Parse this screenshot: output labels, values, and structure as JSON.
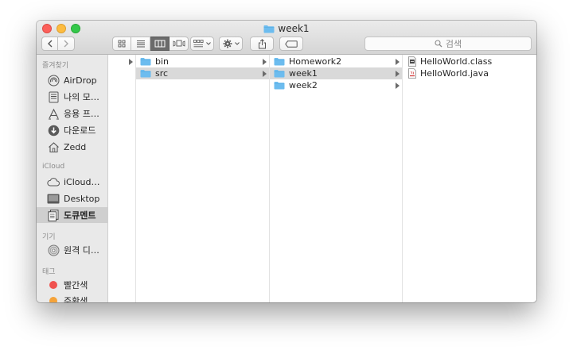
{
  "window": {
    "title": "week1",
    "title_icon": "folder-icon"
  },
  "toolbar": {
    "back_icon": "chevron-left-icon",
    "forward_icon": "chevron-right-icon",
    "view_modes": [
      "icon-view",
      "list-view",
      "column-view",
      "cover-flow-view"
    ],
    "active_view": "column-view",
    "arrange_icon": "arrange-grid-icon",
    "action_icon": "gear-icon",
    "share_icon": "share-icon",
    "tag_icon": "tag-icon",
    "search_placeholder": "검색"
  },
  "sidebar": {
    "sections": [
      {
        "heading": "즐겨찾기",
        "items": [
          {
            "label": "AirDrop",
            "icon": "airdrop-icon"
          },
          {
            "label": "나의 모…",
            "icon": "document-icon"
          },
          {
            "label": "응용 프…",
            "icon": "applications-icon"
          },
          {
            "label": "다운로드",
            "icon": "download-icon"
          },
          {
            "label": "Zedd",
            "icon": "home-icon"
          }
        ]
      },
      {
        "heading": "iCloud",
        "items": [
          {
            "label": "iCloud…",
            "icon": "cloud-icon"
          },
          {
            "label": "Desktop",
            "icon": "desktop-icon"
          },
          {
            "label": "도큐멘트",
            "icon": "documents-icon",
            "selected": true
          }
        ]
      },
      {
        "heading": "기기",
        "items": [
          {
            "label": "원격 디…",
            "icon": "remote-disc-icon"
          }
        ]
      },
      {
        "heading": "태그",
        "items": [
          {
            "label": "빨간색",
            "icon": "tag-dot-icon",
            "color": "#f0524f"
          },
          {
            "label": "주황색",
            "icon": "tag-dot-icon",
            "color": "#f5a33a"
          }
        ]
      }
    ]
  },
  "columns": [
    {
      "items": [
        {
          "name": "bin",
          "kind": "folder",
          "has_children": true
        },
        {
          "name": "src",
          "kind": "folder",
          "has_children": true,
          "selected": true
        }
      ]
    },
    {
      "items": [
        {
          "name": "Homework2",
          "kind": "folder",
          "has_children": true
        },
        {
          "name": "week1",
          "kind": "folder",
          "has_children": true,
          "selected": true
        },
        {
          "name": "week2",
          "kind": "folder",
          "has_children": true
        }
      ]
    },
    {
      "items": [
        {
          "name": "HelloWorld.class",
          "kind": "class-file",
          "has_children": false
        },
        {
          "name": "HelloWorld.java",
          "kind": "java-file",
          "has_children": false
        }
      ]
    }
  ],
  "colors": {
    "folder_blue": "#6cbcef",
    "selection_gray": "#d9d9d9",
    "sidebar_bg": "#e9e9e9"
  }
}
